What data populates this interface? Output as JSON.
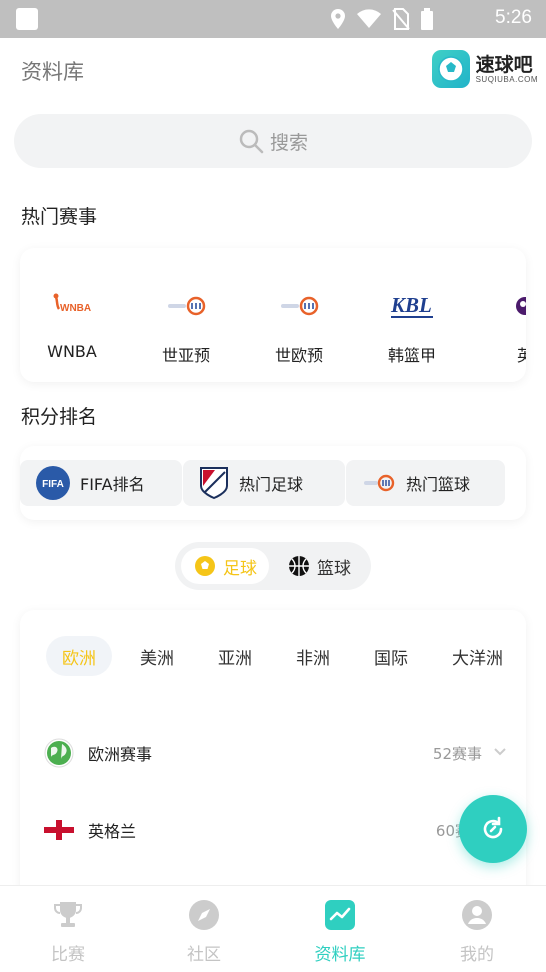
{
  "status_bar": {
    "time": "5:26"
  },
  "header": {
    "title": "资料库",
    "brand_name": "速球吧",
    "brand_sub": "SUQIUBA.COM"
  },
  "search": {
    "placeholder": "搜索"
  },
  "hot_events": {
    "title": "热门赛事",
    "items": [
      {
        "label": "WNBA",
        "icon": "wnba-logo"
      },
      {
        "label": "世亚预",
        "icon": "fiba-asia-logo"
      },
      {
        "label": "世欧预",
        "icon": "fiba-europe-logo"
      },
      {
        "label": "韩篮甲",
        "icon": "kbl-logo"
      },
      {
        "label": "英",
        "icon": "premier-league-logo"
      }
    ]
  },
  "rankings": {
    "title": "积分排名",
    "items": [
      {
        "label": "FIFA排名",
        "icon": "fifa-logo"
      },
      {
        "label": "热门足球",
        "icon": "mls-logo"
      },
      {
        "label": "热门篮球",
        "icon": "fiba-logo"
      }
    ]
  },
  "sport_toggle": {
    "options": [
      {
        "label": "足球",
        "active": true
      },
      {
        "label": "篮球",
        "active": false
      }
    ],
    "active_color": "#f5c518"
  },
  "regions": {
    "tabs": [
      "欧洲",
      "美洲",
      "亚洲",
      "非洲",
      "国际",
      "大洋洲"
    ],
    "active_tab": "欧洲"
  },
  "leagues": [
    {
      "name": "欧洲赛事",
      "count": "52赛事",
      "icon": "globe-icon"
    },
    {
      "name": "英格兰",
      "count": "60赛",
      "icon": "england-flag-icon"
    }
  ],
  "bottom_nav": {
    "items": [
      {
        "label": "比赛",
        "icon": "trophy-icon",
        "active": false
      },
      {
        "label": "社区",
        "icon": "compass-icon",
        "active": false
      },
      {
        "label": "资料库",
        "icon": "chart-icon",
        "active": true
      },
      {
        "label": "我的",
        "icon": "user-icon",
        "active": false
      }
    ],
    "accent": "#2fcfc0"
  }
}
